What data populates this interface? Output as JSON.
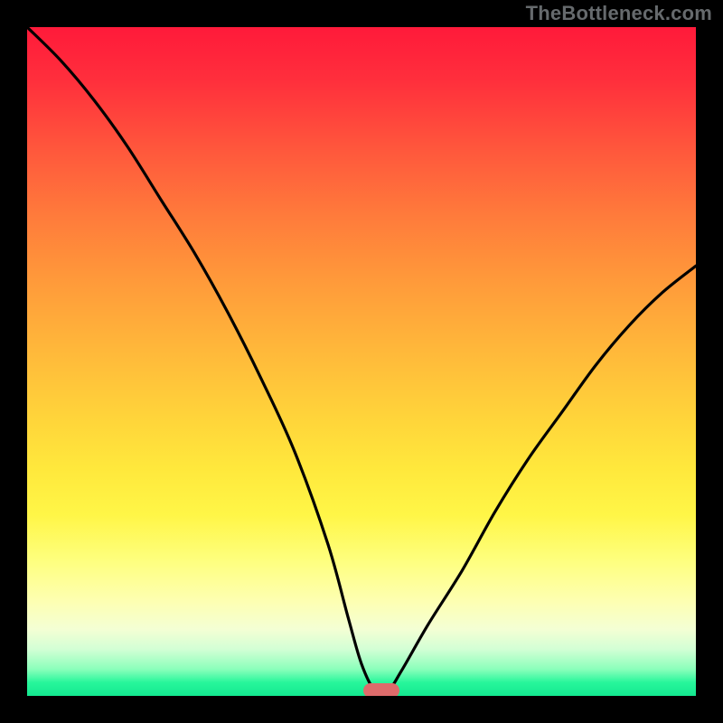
{
  "watermark": "TheBottleneck.com",
  "chart_data": {
    "type": "line",
    "title": "",
    "xlabel": "",
    "ylabel": "",
    "x": [
      0,
      5,
      10,
      15,
      20,
      25,
      30,
      35,
      40,
      45,
      48,
      50,
      52,
      54,
      56,
      60,
      65,
      70,
      75,
      80,
      85,
      90,
      95,
      100
    ],
    "values": [
      100,
      95,
      89,
      82,
      74,
      66,
      57,
      47,
      36,
      22,
      11,
      4,
      0,
      0,
      3,
      10,
      18,
      27,
      35,
      42,
      49,
      55,
      60,
      64
    ],
    "xlim": [
      0,
      100
    ],
    "ylim": [
      0,
      100
    ],
    "min_marker": {
      "x": 53,
      "y": 0,
      "color": "#dd6b6b"
    }
  }
}
